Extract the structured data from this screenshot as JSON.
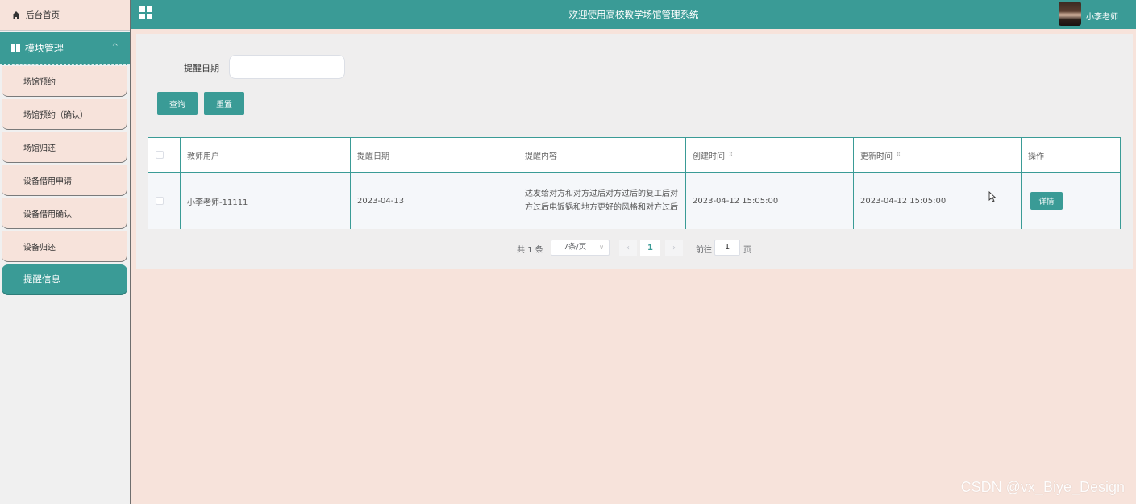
{
  "sidebar": {
    "home_label": "后台首页",
    "group_label": "模块管理",
    "items": [
      {
        "label": "场馆预约"
      },
      {
        "label": "场馆预约（确认）"
      },
      {
        "label": "场馆归还"
      },
      {
        "label": "设备借用申请"
      },
      {
        "label": "设备借用确认"
      },
      {
        "label": "设备归还"
      },
      {
        "label": "提醒信息",
        "active": true
      }
    ]
  },
  "header": {
    "title": "欢迎使用高校教学场馆管理系统",
    "username": "小李老师"
  },
  "search": {
    "label": "提醒日期",
    "value": "",
    "query_button": "查询",
    "reset_button": "重置"
  },
  "table": {
    "columns": [
      "",
      "教师用户",
      "提醒日期",
      "提醒内容",
      "创建时间",
      "更新时间",
      "操作"
    ],
    "rows": [
      {
        "teacher": "小李老师-11111",
        "remind_date": "2023-04-13",
        "content": "达发给对方和对方过后对方过后的复工后对方过后电饭锅和地方更好的风格和对方过后",
        "created": "2023-04-12 15:05:00",
        "updated": "2023-04-12 15:05:00",
        "action": "详情"
      }
    ]
  },
  "pagination": {
    "total": "共 1 条",
    "page_size": "7条/页",
    "current_page": "1",
    "goto_label": "前往",
    "goto_value": "1",
    "page_suffix": "页"
  },
  "watermark": "CSDN @vx_Biye_Design",
  "colors": {
    "accent": "#3a9b96",
    "background": "#f7e3db",
    "panel": "#efeeee"
  }
}
